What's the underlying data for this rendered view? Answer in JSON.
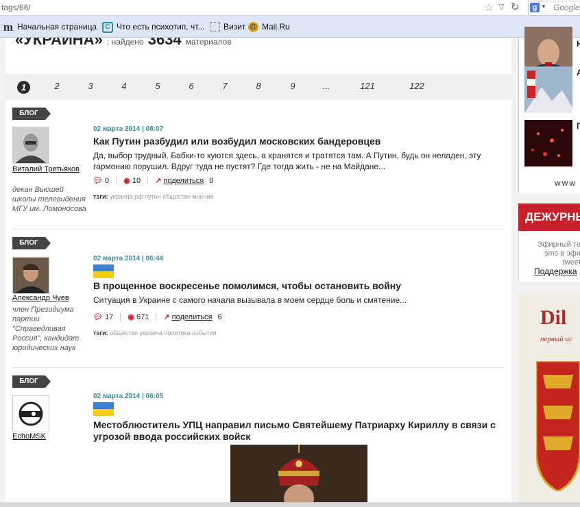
{
  "browser": {
    "url": "tags/66/",
    "search_placeholder": "Google",
    "search_engine_badge": "g",
    "bookmarks": [
      {
        "icon": "m-logo-icon",
        "label": "Начальная страница"
      },
      {
        "icon": "psy-logo-icon",
        "label": "Что есть психотип, чт..."
      },
      {
        "icon": "dotted-page-icon",
        "label": "Визит"
      },
      {
        "icon": "mailru-icon",
        "label": "Mail.Ru"
      }
    ]
  },
  "heading": {
    "title": "«УКРАИНА»",
    "found_label": ": найдено",
    "count": "3634",
    "materials": "материалов"
  },
  "pagination": [
    "1",
    "2",
    "3",
    "4",
    "5",
    "6",
    "7",
    "8",
    "9",
    "...",
    "121",
    "122"
  ],
  "articles": [
    {
      "tag": "БЛОГ",
      "author": "Виталий Третьяков",
      "role": "декан Высшей школы телевидения МГУ им. Ломоносова",
      "date": "02 марта 2014 | 08:07",
      "title": "Как Путин разбудил или возбудил московских бандеровцев",
      "lead": "Да, выбор трудный. Бабки-то куются здесь, а хранятся и тратятся там. А Путин, будь он неладен, эту гармонию порушил. Вдруг туда не пустят? Где тогда жить - не на Майдане...",
      "comments": "0",
      "views": "10",
      "share_label": "поделиться",
      "shares": "0",
      "tags_label": "тэги:",
      "tags": "украина рф путин общество мнения"
    },
    {
      "tag": "БЛОГ",
      "author": "Александр Чуев",
      "role": "член Президиума партии \"Справедливая Россия\", кандидат юридических наук",
      "date": "02 марта 2014 | 06:44",
      "title": "В прощенное воскресенье помолимся, чтобы остановить войну",
      "lead": "Ситуация в Украине с самого начала вызывала в моем сердце боль и смятение...",
      "comments": "17",
      "views": "671",
      "share_label": "поделиться",
      "shares": "6",
      "tags_label": "тэги:",
      "tags": "общество украина политика события"
    },
    {
      "tag": "БЛОГ",
      "author": "EchoMSK",
      "date": "02 марта 2014 | 06:05",
      "title": "Местоблюститель УПЦ направил письмо Святейшему Патриарху Кириллу в связи с угрозой ввода российских войск"
    }
  ],
  "right_column": {
    "news_letters": [
      "Н",
      "А",
      "Г"
    ],
    "www": "www",
    "duty_title": "ДЕЖУРНЫ",
    "duty_lines": [
      "Эфирный те",
      "sms в эфи",
      "tweet"
    ],
    "support_link": "Поддержка",
    "ad_logo": "Dil",
    "ad_sub": "первый ис"
  },
  "colors": {
    "accent_red": "#c8202a",
    "date_teal": "#3a8fa0",
    "flag_blue": "#3f7fd0",
    "flag_yellow": "#f3cf1a"
  }
}
